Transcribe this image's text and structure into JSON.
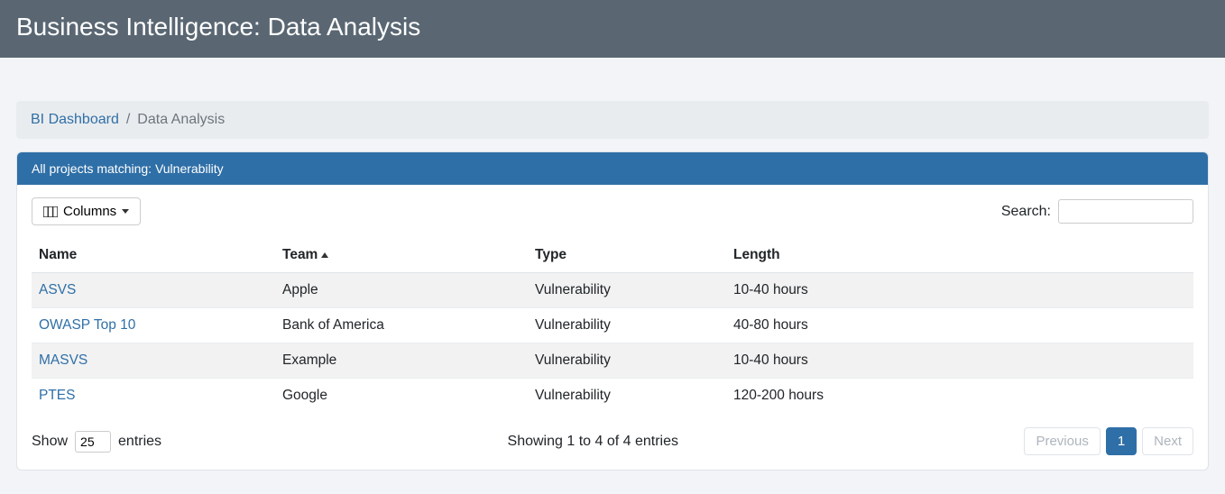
{
  "header": {
    "title": "Business Intelligence: Data Analysis"
  },
  "breadcrumb": {
    "root": "BI Dashboard",
    "current": "Data Analysis"
  },
  "card": {
    "header": "All projects matching: Vulnerability",
    "columns_btn": "Columns",
    "search_label": "Search:"
  },
  "table": {
    "headers": {
      "name": "Name",
      "team": "Team",
      "type": "Type",
      "length": "Length"
    },
    "rows": [
      {
        "name": "ASVS",
        "team": "Apple",
        "type": "Vulnerability",
        "length": "10-40 hours"
      },
      {
        "name": "OWASP Top 10",
        "team": "Bank of America",
        "type": "Vulnerability",
        "length": "40-80 hours"
      },
      {
        "name": "MASVS",
        "team": "Example",
        "type": "Vulnerability",
        "length": "10-40 hours"
      },
      {
        "name": "PTES",
        "team": "Google",
        "type": "Vulnerability",
        "length": "120-200 hours"
      }
    ]
  },
  "footer": {
    "show_prefix": "Show",
    "show_value": "25",
    "show_suffix": "entries",
    "info": "Showing 1 to 4 of 4 entries",
    "prev": "Previous",
    "page1": "1",
    "next": "Next"
  }
}
